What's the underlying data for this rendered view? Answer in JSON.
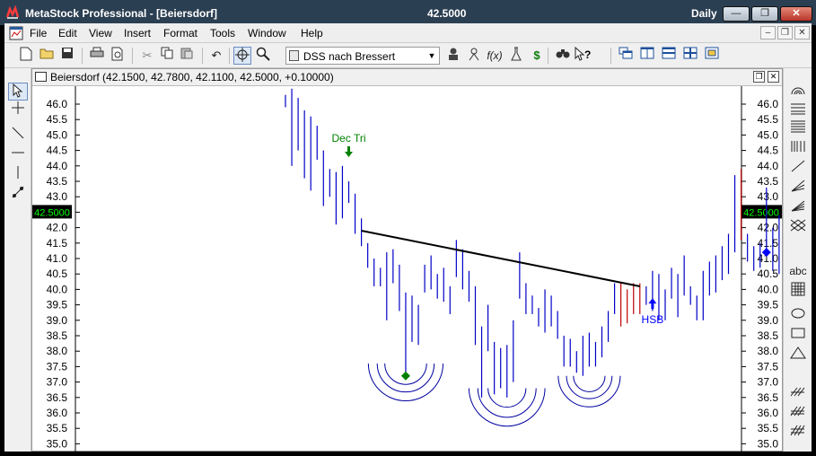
{
  "window": {
    "title": "MetaStock Professional - [Beiersdorf]",
    "last_price": "42.5000",
    "periodicity": "Daily",
    "min_label": "—",
    "max_label": "❐",
    "close_label": "✕"
  },
  "menu": {
    "items": [
      "File",
      "Edit",
      "View",
      "Insert",
      "Format",
      "Tools",
      "Window",
      "Help"
    ],
    "mdi_min": "–",
    "mdi_restore": "❐",
    "mdi_close": "✕"
  },
  "toolbar": {
    "template": "DSS nach Bressert",
    "icons": {
      "new": "new-file-icon",
      "open": "open-folder-icon",
      "save": "save-icon",
      "print": "print-icon",
      "preview": "print-preview-icon",
      "cut": "cut-icon",
      "copy": "copy-icon",
      "paste": "paste-icon",
      "undo": "undo-icon",
      "crosshair": "crosshair-icon",
      "zoom": "zoom-icon"
    },
    "symbols": {
      "indicator_builder": "f(x)",
      "profit": "$",
      "help": "?"
    }
  },
  "chart_window": {
    "title": "Beiersdorf (42.1500, 42.7800, 42.1100, 42.5000, +0.10000)"
  },
  "right_tools": {
    "text_tool": "abc"
  },
  "colors": {
    "bars": "#0000c8",
    "down_bars": "#c00000",
    "price_marker_bg": "#000000",
    "price_marker_fg": "#00ff00",
    "signal_green": "#008000",
    "signal_blue": "#0000ff",
    "trendline": "#000000"
  },
  "chart_data": {
    "type": "ohlc",
    "ylim": [
      35.0,
      46.0
    ],
    "y_ticks": [
      "46.0",
      "45.5",
      "45.0",
      "44.5",
      "44.0",
      "43.5",
      "43.0",
      "42.5",
      "42.0",
      "41.5",
      "41.0",
      "40.5",
      "40.0",
      "39.5",
      "39.0",
      "38.5",
      "38.0",
      "37.5",
      "37.0",
      "36.5",
      "36.0",
      "35.5",
      "35.0"
    ],
    "last_price_label": "42.5000",
    "bars": [
      [
        45.9,
        46.3
      ],
      [
        46.5,
        44.0
      ],
      [
        46.2,
        44.5
      ],
      [
        45.8,
        43.6
      ],
      [
        45.6,
        43.2
      ],
      [
        45.3,
        44.2
      ],
      [
        44.5,
        42.7
      ],
      [
        43.9,
        43.0
      ],
      [
        43.8,
        42.1
      ],
      [
        44.0,
        42.3
      ],
      [
        43.5,
        42.8
      ],
      [
        43.1,
        41.8
      ],
      [
        42.3,
        41.4
      ],
      [
        41.5,
        40.7
      ],
      [
        41.0,
        40.1
      ],
      [
        40.7,
        40.1
      ],
      [
        41.2,
        39.0
      ],
      [
        41.3,
        40.2
      ],
      [
        40.8,
        39.3
      ],
      [
        39.9,
        37.2
      ],
      [
        39.8,
        38.3
      ],
      [
        39.5,
        38.2
      ],
      [
        40.8,
        39.9
      ],
      [
        41.1,
        40.0
      ],
      [
        40.5,
        39.7
      ],
      [
        40.7,
        39.6
      ],
      [
        40.1,
        39.2
      ],
      [
        41.6,
        40.4
      ],
      [
        41.3,
        40.0
      ],
      [
        40.6,
        39.6
      ],
      [
        40.1,
        38.2
      ],
      [
        38.8,
        36.5
      ],
      [
        39.5,
        38.0
      ],
      [
        38.3,
        36.6
      ],
      [
        38.1,
        36.8
      ],
      [
        38.2,
        36.5
      ],
      [
        39.0,
        37.0
      ],
      [
        41.2,
        39.7
      ],
      [
        40.2,
        39.2
      ],
      [
        39.8,
        39.2
      ],
      [
        39.4,
        38.8
      ],
      [
        40.0,
        38.6
      ],
      [
        39.8,
        38.8
      ],
      [
        39.3,
        38.4
      ],
      [
        38.5,
        37.5
      ],
      [
        38.4,
        37.5
      ],
      [
        38.0,
        37.3
      ],
      [
        38.5,
        37.2
      ],
      [
        38.6,
        37.5
      ],
      [
        38.3,
        37.5
      ],
      [
        38.8,
        37.8
      ],
      [
        39.3,
        38.3
      ],
      [
        40.2,
        39.2
      ],
      [
        40.2,
        38.8
      ],
      [
        40.0,
        38.9
      ],
      [
        40.2,
        39.2
      ],
      [
        40.2,
        39.2
      ],
      [
        40.1,
        39.5
      ],
      [
        40.6,
        39.3
      ],
      [
        40.5,
        39.0
      ],
      [
        40.0,
        39.0
      ],
      [
        40.7,
        39.7
      ],
      [
        40.5,
        39.1
      ],
      [
        41.1,
        39.8
      ],
      [
        40.1,
        39.5
      ],
      [
        39.8,
        39.0
      ],
      [
        40.6,
        39.0
      ],
      [
        40.9,
        39.8
      ],
      [
        41.1,
        39.9
      ],
      [
        41.4,
        40.3
      ],
      [
        41.8,
        40.5
      ],
      [
        43.7,
        41.2
      ],
      [
        43.9,
        41.6
      ],
      [
        41.8,
        40.9
      ],
      [
        41.4,
        40.6
      ],
      [
        41.5,
        40.7
      ],
      [
        43.3,
        41.1
      ],
      [
        42.0,
        40.6
      ],
      [
        42.4,
        40.5
      ],
      [
        42.6,
        40.9
      ],
      [
        44.0,
        41.5
      ]
    ],
    "trendline": {
      "from": [
        12,
        41.9
      ],
      "to": [
        56,
        40.1
      ]
    },
    "signals": [
      {
        "label": "Dec Tri",
        "type": "arrow-down",
        "x": 10,
        "y": 44.4,
        "color": "green"
      },
      {
        "label": "HSB",
        "type": "arrow-up",
        "x": 58,
        "y": 39.6,
        "color": "blue"
      },
      {
        "label": "",
        "type": "diamond",
        "x": 19,
        "y": 37.2,
        "color": "green"
      },
      {
        "label": "",
        "type": "diamond",
        "x": 76,
        "y": 41.2,
        "color": "blue"
      }
    ],
    "cup_arcs": [
      {
        "cx": 19,
        "top": 37.6,
        "radii": [
          3.3,
          4.5,
          5.9
        ]
      },
      {
        "cx": 35,
        "top": 36.8,
        "radii": [
          3.0,
          4.6,
          6.0
        ]
      },
      {
        "cx": 48,
        "top": 37.2,
        "radii": [
          2.5,
          3.6,
          4.9
        ]
      }
    ]
  }
}
